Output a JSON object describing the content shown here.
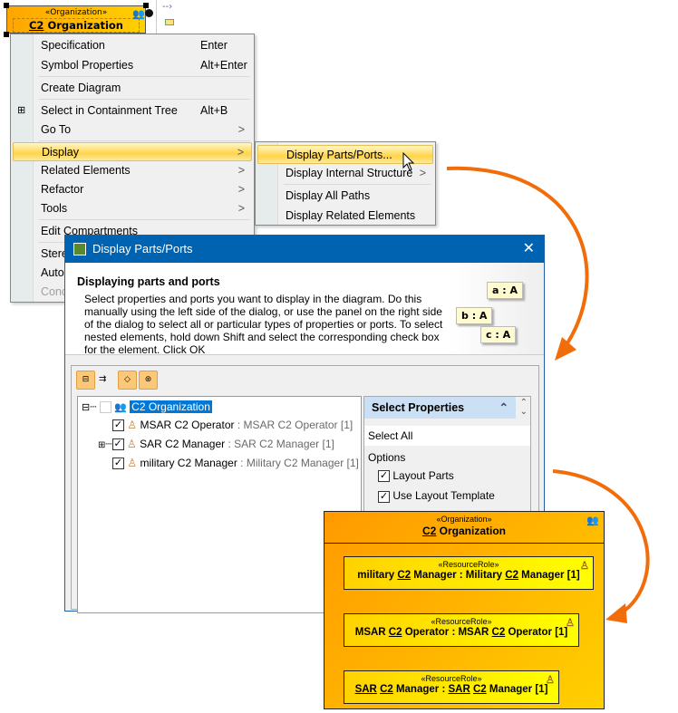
{
  "diagram_top": {
    "stereotype": "«Organization»",
    "name_u": "C2",
    "name_rest": " Organization"
  },
  "context_menu": {
    "items": [
      {
        "label": "Specification",
        "shortcut": "Enter"
      },
      {
        "label": "Symbol Properties",
        "shortcut": "Alt+Enter"
      },
      {
        "label": "Create Diagram"
      },
      {
        "label": "Select in Containment Tree",
        "shortcut": "Alt+B"
      },
      {
        "label": "Go To"
      },
      {
        "label": "Display"
      },
      {
        "label": "Related Elements"
      },
      {
        "label": "Refactor"
      },
      {
        "label": "Tools"
      },
      {
        "label": "Edit Compartments"
      },
      {
        "label": "Stere"
      },
      {
        "label": "Auto"
      },
      {
        "label": "Conc"
      }
    ],
    "submenu_arrow": ">"
  },
  "submenu": {
    "items": [
      {
        "label": "Display Parts/Ports..."
      },
      {
        "label": "Display Internal Structure"
      },
      {
        "label": "Display All Paths"
      },
      {
        "label": "Display Related Elements"
      }
    ]
  },
  "dialog": {
    "title": "Display Parts/Ports",
    "heading": "Displaying parts and ports",
    "description": "Select properties and ports you want to display in the diagram. Do this manually using the left side of the dialog, or use the panel on the right side of the dialog to select all or particular types of properties or ports. To select nested elements, hold down Shift and select the corresponding check box for the element. Click OK",
    "illustration": [
      "a : A",
      "b : A",
      "c : A"
    ],
    "tree": {
      "root": "C2 Organization",
      "children": [
        {
          "name": "MSAR C2 Operator",
          "type": " : MSAR C2 Operator [1]",
          "checked": true
        },
        {
          "name": "SAR C2 Manager",
          "type": " : SAR C2 Manager [1]",
          "checked": true
        },
        {
          "name": "military C2 Manager",
          "type": " : Military C2 Manager [1]",
          "checked": true
        }
      ]
    },
    "right_panel": {
      "title": "Select Properties",
      "select_all": "Select All",
      "options_label": "Options",
      "layout_parts": "Layout Parts",
      "use_layout_template": "Use Layout Template"
    }
  },
  "diagram_result": {
    "stereotype": "«Organization»",
    "name_u": "C2",
    "name_rest": " Organization",
    "role_stereotype": "«ResourceRole»",
    "roles": [
      {
        "a": "military ",
        "b": "C2",
        "c": " Manager : Military ",
        "d": "C2",
        "e": " Manager [1]"
      },
      {
        "a": "MSAR ",
        "b": "C2",
        "c": " Operator : MSAR ",
        "d": "C2",
        "e": " Operator [1]"
      },
      {
        "a": "SAR",
        "b": "C2",
        "c": " Manager : ",
        "d": "SAR",
        "e": "C2",
        "f": " Manager [1]"
      }
    ]
  },
  "colors": {
    "accent": "#0063b1",
    "arrow": "#f36c0a",
    "highlight": "#ffd448"
  }
}
